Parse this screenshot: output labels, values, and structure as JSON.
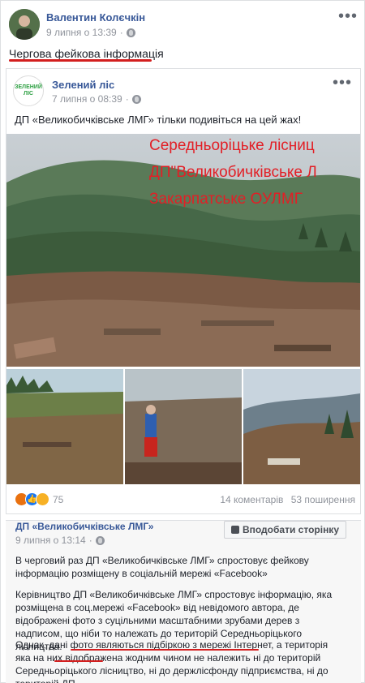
{
  "post": {
    "author": "Валентин Колєчкін",
    "date": "9 липня о 13:39",
    "text": "Чергова фейкова інформація"
  },
  "shared": {
    "author": "Зелений ліс",
    "logo_text": "ЗЕЛЕНИЙ ЛІС",
    "date": "7 липня о 08:39",
    "text": "ДП «Великобичківське ЛМГ» тільки подивіться на цей жах!",
    "photo_overlay": [
      "Середньоріцьке лісниц",
      "ДП\"Великобичківське Л",
      "Закарпатське ОУЛМГ"
    ],
    "reaction_count": "75",
    "comments": "14 коментарів",
    "shares": "53 поширення"
  },
  "page_post": {
    "author": "ДП «Великобичківське ЛМГ»",
    "date": "9 липня о 13:14",
    "like_button": "Вподобати сторінку",
    "paragraphs": [
      "В черговий раз ДП «Великобичківське ЛМГ» спростовує фейкову інформацію розміщену в соціальній мережі «Facebook»",
      "Керівництво ДП «Великобичківське ЛМГ» спростовує інформацію, яка розміщена в соц.мережі «Facebook» від невідомого автора, де відображені фото з суцільними масштабними зрубами дерев з надписом, що ніби то належать до територій Середньоріцького лісництва.",
      "Однак, дані фото являються підбіркою з мережі Інтернет, а територія яка на них відображена жодним чином не належить ні до територій Середньоріцького лісництво, ні до держлісфонду підприємства, ні до територій ДП"
    ]
  },
  "colors": {
    "link": "#385898",
    "accent_red": "#d31f1f",
    "meta": "#90949c"
  }
}
